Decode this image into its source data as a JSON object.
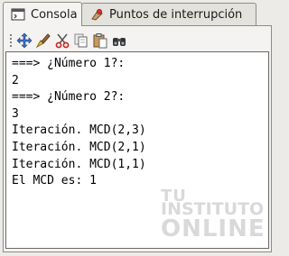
{
  "tabs": [
    {
      "label": "Consola",
      "icon": "console-icon",
      "active": true
    },
    {
      "label": "Puntos de interrupción",
      "icon": "breakpoint-icon",
      "active": false
    }
  ],
  "toolbar": {
    "buttons": [
      "move-icon",
      "clear-icon",
      "cut-icon",
      "copy-icon",
      "paste-icon",
      "find-icon"
    ]
  },
  "console": {
    "lines": [
      "===> ¿Número 1?:",
      "2",
      "===> ¿Número 2?:",
      "3",
      "Iteración. MCD(2,3)",
      "Iteración. MCD(2,1)",
      "Iteración. MCD(1,1)",
      "El MCD es: 1"
    ]
  },
  "watermark": {
    "line1": "TU",
    "line2": "INSTITUTO",
    "line3": "ONLINE"
  }
}
